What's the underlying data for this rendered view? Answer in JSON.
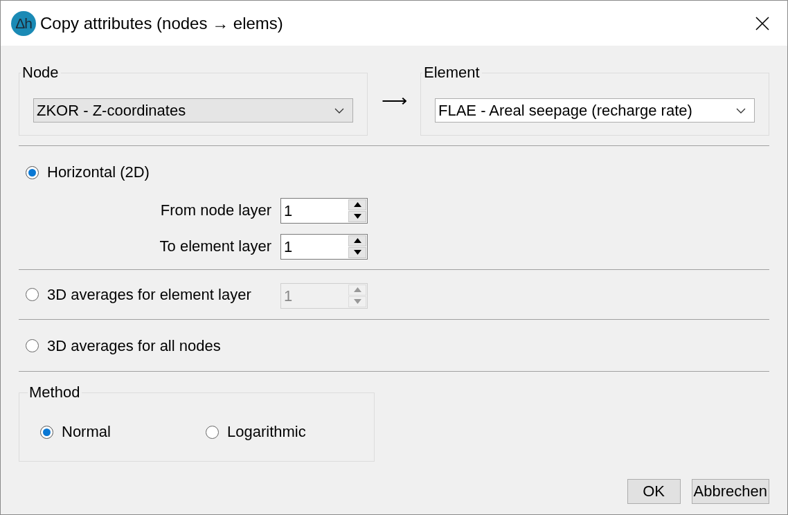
{
  "window": {
    "logo_text": "Δh",
    "title": "Copy attributes (nodes → elems)"
  },
  "source": {
    "label": "Node",
    "value": "ZKOR - Z-coordinates",
    "highlighted": true
  },
  "arrow": "⟶",
  "target": {
    "label": "Element",
    "value": "FLAE - Areal seepage (recharge rate)",
    "highlighted": false
  },
  "modes": [
    {
      "kind": "stacked",
      "label": "Horizontal (2D)",
      "selected": true,
      "fields": [
        {
          "label": "From node layer",
          "value": "1",
          "disabled": false
        },
        {
          "label": "To element layer",
          "value": "1",
          "disabled": false
        }
      ]
    },
    {
      "kind": "inline",
      "label": "3D averages for element layer",
      "selected": false,
      "fields": [
        {
          "value": "1",
          "disabled": true
        }
      ]
    },
    {
      "kind": "plain",
      "label": "3D averages for all nodes",
      "selected": false
    }
  ],
  "method": {
    "label": "Method",
    "options": [
      {
        "label": "Normal",
        "selected": true
      },
      {
        "label": "Logarithmic",
        "selected": false
      }
    ]
  },
  "buttons": [
    "OK",
    "Abbrechen"
  ]
}
